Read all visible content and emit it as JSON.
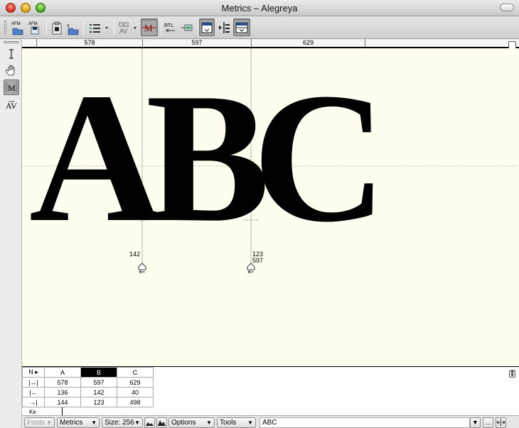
{
  "window": {
    "title": "Metrics – Alegreya"
  },
  "ruler": {
    "values": [
      "578",
      "597",
      "629"
    ]
  },
  "canvas": {
    "glyphs": [
      "A",
      "B",
      "C"
    ],
    "left_markers": [
      {
        "value": "142"
      },
      {
        "value": "123",
        "value2": "597"
      }
    ]
  },
  "metrics_table": {
    "corner": "N ▸",
    "columns": [
      "A",
      "B",
      "C"
    ],
    "selected_column": "B",
    "rows": [
      {
        "icon": "advance-width-icon",
        "symbol": "|↔|",
        "values": [
          "578",
          "597",
          "629"
        ]
      },
      {
        "icon": "left-bearing-icon",
        "symbol": "|←",
        "values": [
          "136",
          "142",
          "40"
        ]
      },
      {
        "icon": "right-bearing-icon",
        "symbol": "→|",
        "values": [
          "144",
          "123",
          "498"
        ]
      }
    ],
    "kern_label": "Ke"
  },
  "statusbar": {
    "fonts": "Fonts",
    "metrics": "Metrics",
    "size": "Size: 256",
    "options": "Options",
    "tools": "Tools",
    "text": "ABC",
    "more": "..."
  },
  "colors": {
    "canvas_bg": "#fefef0",
    "selected_col": "#000000"
  }
}
